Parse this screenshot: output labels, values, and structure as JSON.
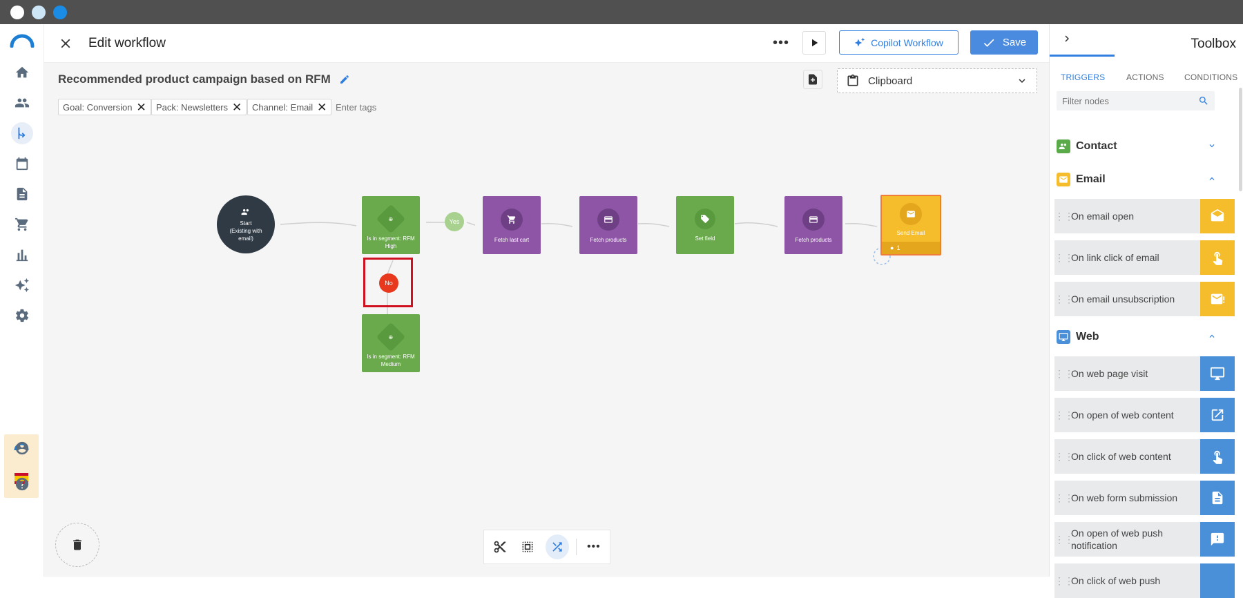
{
  "window": {
    "dots": [
      "#ffffff",
      "#cde6f7",
      "#1a8ce6"
    ]
  },
  "header": {
    "title": "Edit workflow",
    "copilot_label": "Copilot Workflow",
    "save_label": "Save"
  },
  "workflow": {
    "name": "Recommended product campaign based on RFM",
    "tags": [
      "Goal: Conversion",
      "Pack: Newsletters",
      "Channel: Email"
    ],
    "tags_placeholder": "Enter tags",
    "clipboard_label": "Clipboard"
  },
  "nodes": {
    "start": {
      "title": "Start",
      "subtitle": "(Existing with email)"
    },
    "segment_high": "Is in segment: RFM High",
    "yes": "Yes",
    "fetch_cart": "Fetch last cart",
    "fetch_products_1": "Fetch products",
    "set_field": "Set field",
    "fetch_products_2": "Fetch products",
    "send_email": "Send Email",
    "send_email_count": "1",
    "no": "No",
    "segment_medium": "Is in segment: RFM Medium"
  },
  "toolbox": {
    "title": "Toolbox",
    "tabs": [
      "TRIGGERS",
      "ACTIONS",
      "CONDITIONS"
    ],
    "active_tab": 0,
    "filter_placeholder": "Filter nodes",
    "sections": [
      {
        "title": "Contact",
        "color": "#5aaa4a",
        "items": []
      },
      {
        "title": "Email",
        "color": "#f5bd2b",
        "items": [
          "On email open",
          "On link click of email",
          "On email unsubscription"
        ]
      },
      {
        "title": "Web",
        "color": "#4a90d9",
        "items": [
          "On web page visit",
          "On open of web content",
          "On click of web content",
          "On web form submission",
          "On open of web push notification",
          "On click of web push"
        ]
      }
    ]
  },
  "colors": {
    "accent": "#2f7ee0",
    "green": "#6aaa4d",
    "purple": "#8e55a6",
    "yellow": "#f5bd2b",
    "red": "#e8381e",
    "dark": "#2f3a45"
  }
}
